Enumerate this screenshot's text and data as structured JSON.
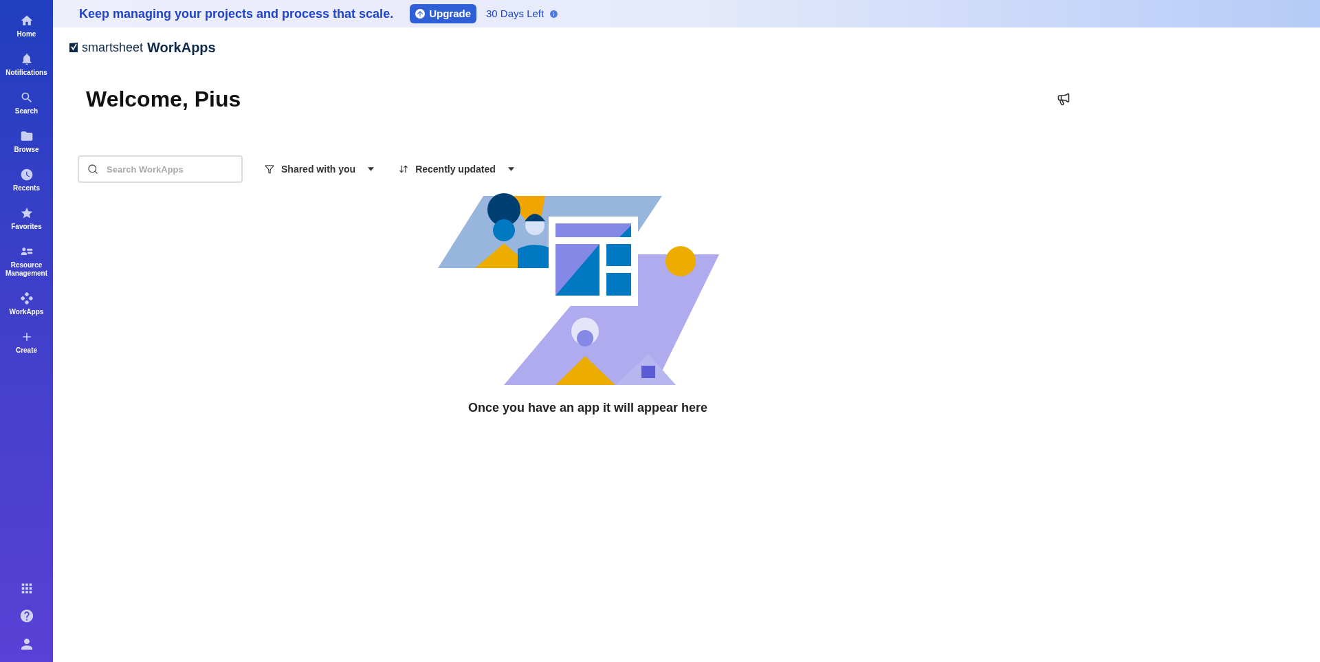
{
  "sidebar": {
    "items": [
      {
        "label": "Home"
      },
      {
        "label": "Notifications"
      },
      {
        "label": "Search"
      },
      {
        "label": "Browse"
      },
      {
        "label": "Recents"
      },
      {
        "label": "Favorites"
      },
      {
        "label": "Resource Management"
      },
      {
        "label": "WorkApps"
      },
      {
        "label": "Create"
      }
    ]
  },
  "banner": {
    "message": "Keep managing your projects and process that scale.",
    "button": "Upgrade",
    "trial": "30 Days Left"
  },
  "logo": {
    "brand": "smartsheet",
    "product": "WorkApps"
  },
  "heading": "Welcome, Pius",
  "search": {
    "placeholder": "Search WorkApps"
  },
  "filters": [
    {
      "label": "Shared with you",
      "kind": "filter"
    },
    {
      "label": "Recently updated",
      "kind": "sort"
    }
  ],
  "empty_state": {
    "message": "Once you have an app it will appear here"
  }
}
